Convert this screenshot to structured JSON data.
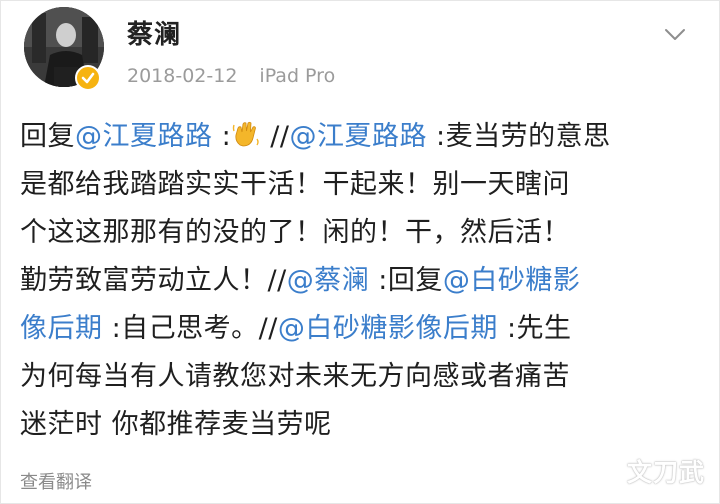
{
  "post": {
    "username": "蔡澜",
    "date": "2018-02-12",
    "device": "iPad Pro",
    "translate_label": "查看翻译",
    "icons": {
      "avatar": "avatar",
      "verified": "verified-badge-icon",
      "more": "chevron-down-icon",
      "emoji": "waving-hand-emoji-icon"
    },
    "colors": {
      "mention": "#3b7ecb",
      "text": "#1f1f1f",
      "meta": "#9b9b9b",
      "verified": "#f6b311"
    },
    "body": {
      "l1_reply": "回复",
      "l1_mention1": "@江夏路路",
      "l1_colon": " :",
      "l1_sep": " //",
      "l1_mention2": "@江夏路路",
      "l1_text": " :麦当劳的意思",
      "l2": "是都给我踏踏实实干活！干起来！别一天瞎问",
      "l3": "个这这那那有的没的了！闲的！干，然后活！",
      "l4_text": "勤劳致富劳动立人！//",
      "l4_mention": "@蔡澜",
      "l4_reply": " :回复",
      "l4_mention2": "@白砂糖影",
      "l5_mention": "像后期",
      "l5_text": " :自己思考。//",
      "l5_mention2": "@白砂糖影像后期",
      "l5_text2": " :先生",
      "l6": "为何每当有人请教您对未来无方向感或者痛苦",
      "l7": "迷茫时 你都推荐麦当劳呢"
    }
  },
  "watermark": "文刀武"
}
